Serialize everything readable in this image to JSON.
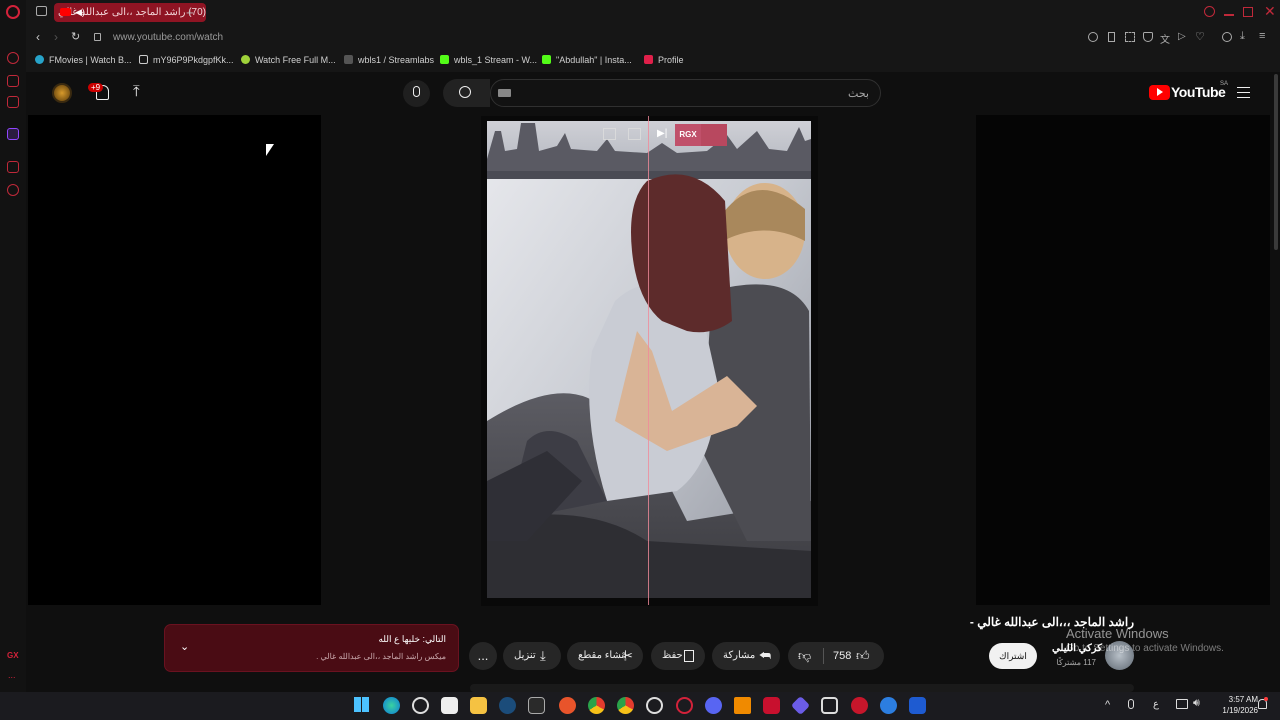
{
  "browser": {
    "tab_title": "(70) راشد الماجد ،،الى عبدالله غالي",
    "tab_plus": "+",
    "url": "www.youtube.com/watch",
    "bookmarks": [
      {
        "label": "FMovies | Watch B...",
        "color": "#27a3c9"
      },
      {
        "label": "mY96P9PkdgpfKk...",
        "color": "#cfcfcf"
      },
      {
        "label": "Watch Free Full M...",
        "color": "#9fd23a"
      },
      {
        "label": "wbls1 / Streamlabs",
        "color": "#666666"
      },
      {
        "label": "wbls_1 Stream - W...",
        "color": "#53fc18"
      },
      {
        "label": "\"Abdullah\" | Insta...",
        "color": "#53fc18"
      },
      {
        "label": "Profile",
        "color": "#e0204a"
      }
    ],
    "rail_bottom_label": "GX",
    "rail_more": "..."
  },
  "youtube": {
    "logo_text": "YouTube",
    "region": "SA",
    "search_placeholder": "بحث",
    "notif_badge": "+9",
    "player_controls": [
      "RGX"
    ]
  },
  "video": {
    "title": "راشد الماجد ،،،الى عبدالله غالي -",
    "channel_name": "كركي الليلي",
    "subscribers": "117 مشتركًا",
    "subscribe_label": "اشتراك",
    "likes": "758",
    "share_label": "مشاركة",
    "save_label": "حفظ",
    "clip_label": "إنشاء مقطع",
    "download_label": "تنزيل",
    "more_label": "..."
  },
  "up_next": {
    "title": "التالي: خليها ع الله",
    "subtitle": "ميكس راشد الماجد ،،الى عبدالله غالي ."
  },
  "overlay": {
    "activate_title": "Activate Windows",
    "activate_sub": "Go to Settings to activate Windows."
  },
  "taskbar": {
    "time": "3:57 AM",
    "date": "1/19/2026",
    "lang": "ع",
    "tray_arrow": "^"
  }
}
